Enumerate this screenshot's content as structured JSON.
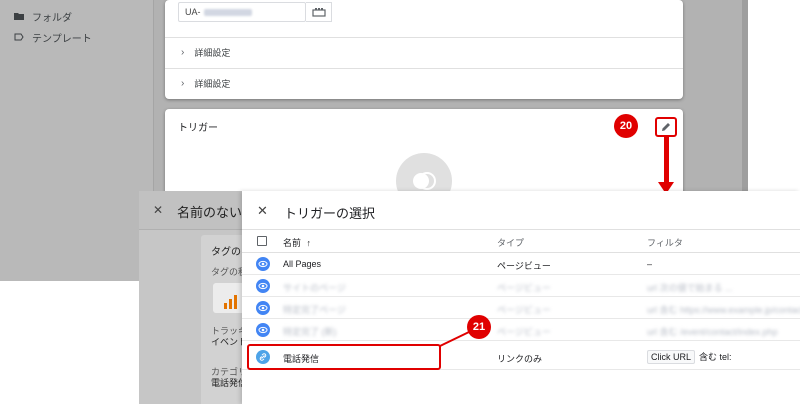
{
  "sidebar": {
    "items": [
      {
        "label": "フォルダ",
        "icon": "folder-icon"
      },
      {
        "label": "テンプレート",
        "icon": "label-icon"
      }
    ]
  },
  "tag_config": {
    "ua_prefix": "UA-",
    "advanced_rows": [
      "詳細設定",
      "詳細設定"
    ]
  },
  "trigger_card": {
    "title": "トリガー"
  },
  "new_tag_panel": {
    "title": "名前のないタ",
    "section_title": "タグの",
    "tag_type_label": "タグの種",
    "tracking_label": "トラッキ",
    "tracking_value": "イベント",
    "category_label": "カテゴリ",
    "category_value": "電話発信"
  },
  "trigger_dialog": {
    "title": "トリガーの選択",
    "columns": {
      "name": "名前",
      "sort_icon": "↑",
      "type": "タイプ",
      "filter": "フィルタ"
    },
    "rows": [
      {
        "name": "All Pages",
        "type": "ページビュー",
        "filter": "–",
        "icon": "eye-icon",
        "color": "#4285f4",
        "blurred": false
      },
      {
        "name": "サイトのページ",
        "type": "ページビュー",
        "filter": "url 次の値で始まる ...",
        "icon": "eye-icon",
        "color": "#4285f4",
        "blurred": true
      },
      {
        "name": "特定完了ページ",
        "type": "ページビュー",
        "filter": "url 含む https://www.example.jp/contact",
        "icon": "eye-icon",
        "color": "#4285f4",
        "blurred": true
      },
      {
        "name": "特定完了 (新)",
        "type": "ページビュー",
        "filter": "url 含む /event/contact/index.php",
        "icon": "eye-icon",
        "color": "#4285f4",
        "blurred": true
      },
      {
        "name": "電話発信",
        "type": "リンクのみ",
        "filter_chip": "Click URL",
        "filter": "含む tel:",
        "icon": "link-icon",
        "color": "#4da3e8",
        "blurred": false
      }
    ]
  },
  "annotations": {
    "step_20": "20",
    "step_21": "21",
    "accent_color": "#e00000"
  }
}
